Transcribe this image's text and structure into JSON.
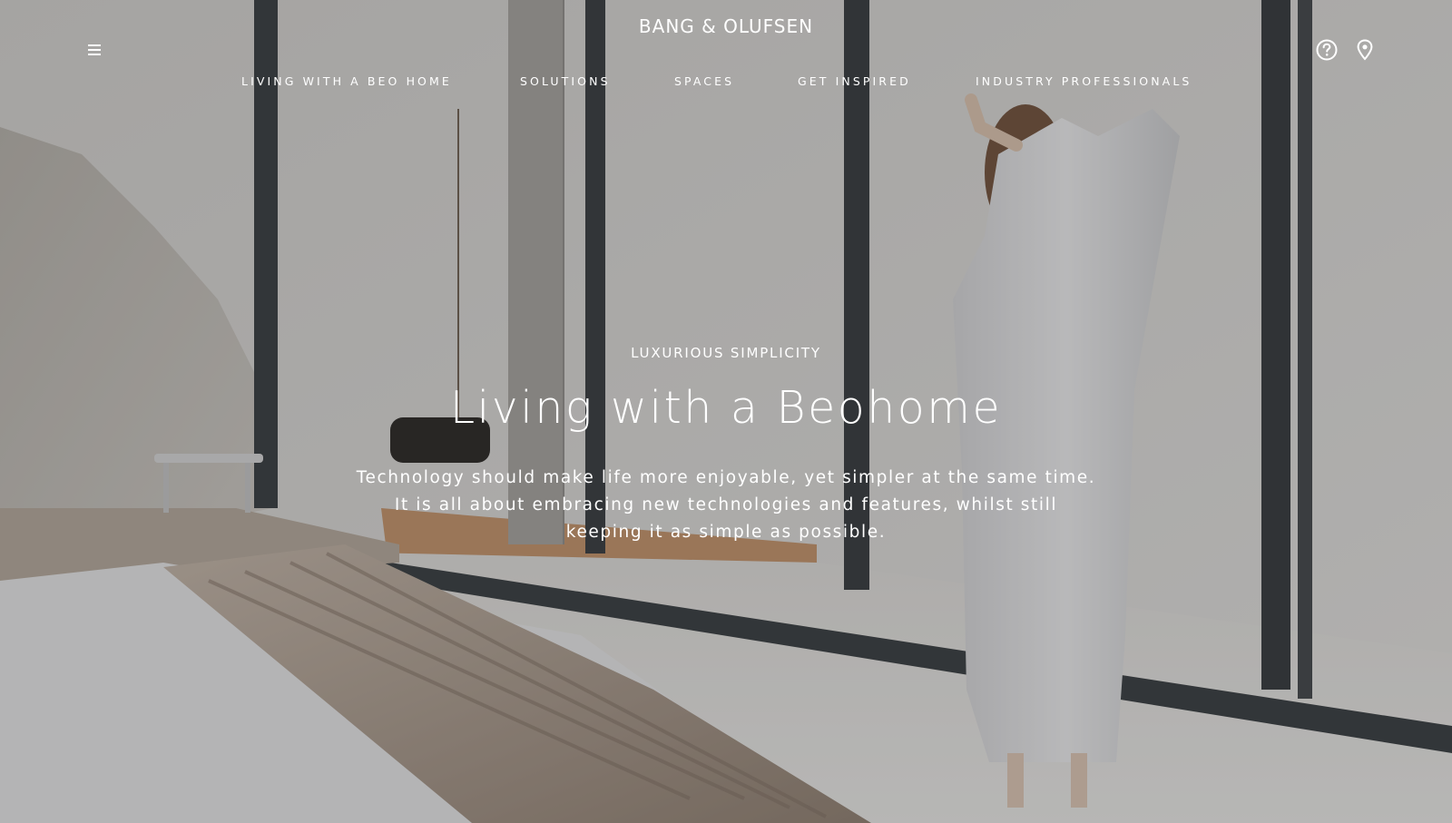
{
  "header": {
    "brand": "BANG & OLUFSEN",
    "menu_icon": "hamburger-menu-icon",
    "help_icon": "help-circle-icon",
    "location_icon": "location-pin-icon"
  },
  "nav": {
    "items": [
      "LIVING WITH A BEO HOME",
      "SOLUTIONS",
      "SPACES",
      "GET INSPIRED",
      "INDUSTRY PROFESSIONALS"
    ]
  },
  "hero": {
    "eyebrow": "LUXURIOUS SIMPLICITY",
    "title": "Living with a Beohome",
    "body": "Technology should make life more enjoyable, yet simpler at the same time. It is all about embracing new technologies and features, whilst still keeping it as simple as possible."
  },
  "colors": {
    "text": "#ffffff",
    "overlay": "#3c3c3c"
  }
}
